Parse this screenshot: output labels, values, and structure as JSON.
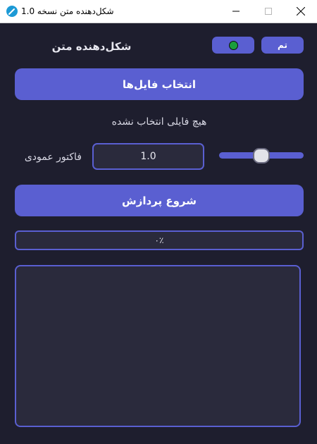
{
  "window": {
    "title": "شکل‌دهنده متن نسخه 1.0"
  },
  "header": {
    "app_title": "شکل‌دهنده متن",
    "theme_label": "تم",
    "color_dot": "#1a9e3c",
    "accent": "#5a5fd1",
    "background": "#1e1e2e"
  },
  "main": {
    "select_files_label": "انتخاب فایل‌ها",
    "status_text": "هیچ فایلی انتخاب نشده",
    "factor_label": "فاکتور عمودی",
    "factor_value": "1.0",
    "slider_level": 0.5,
    "start_label": "شروع پردازش",
    "progress_text": "۰٪",
    "progress_value": 0,
    "log_text": ""
  }
}
